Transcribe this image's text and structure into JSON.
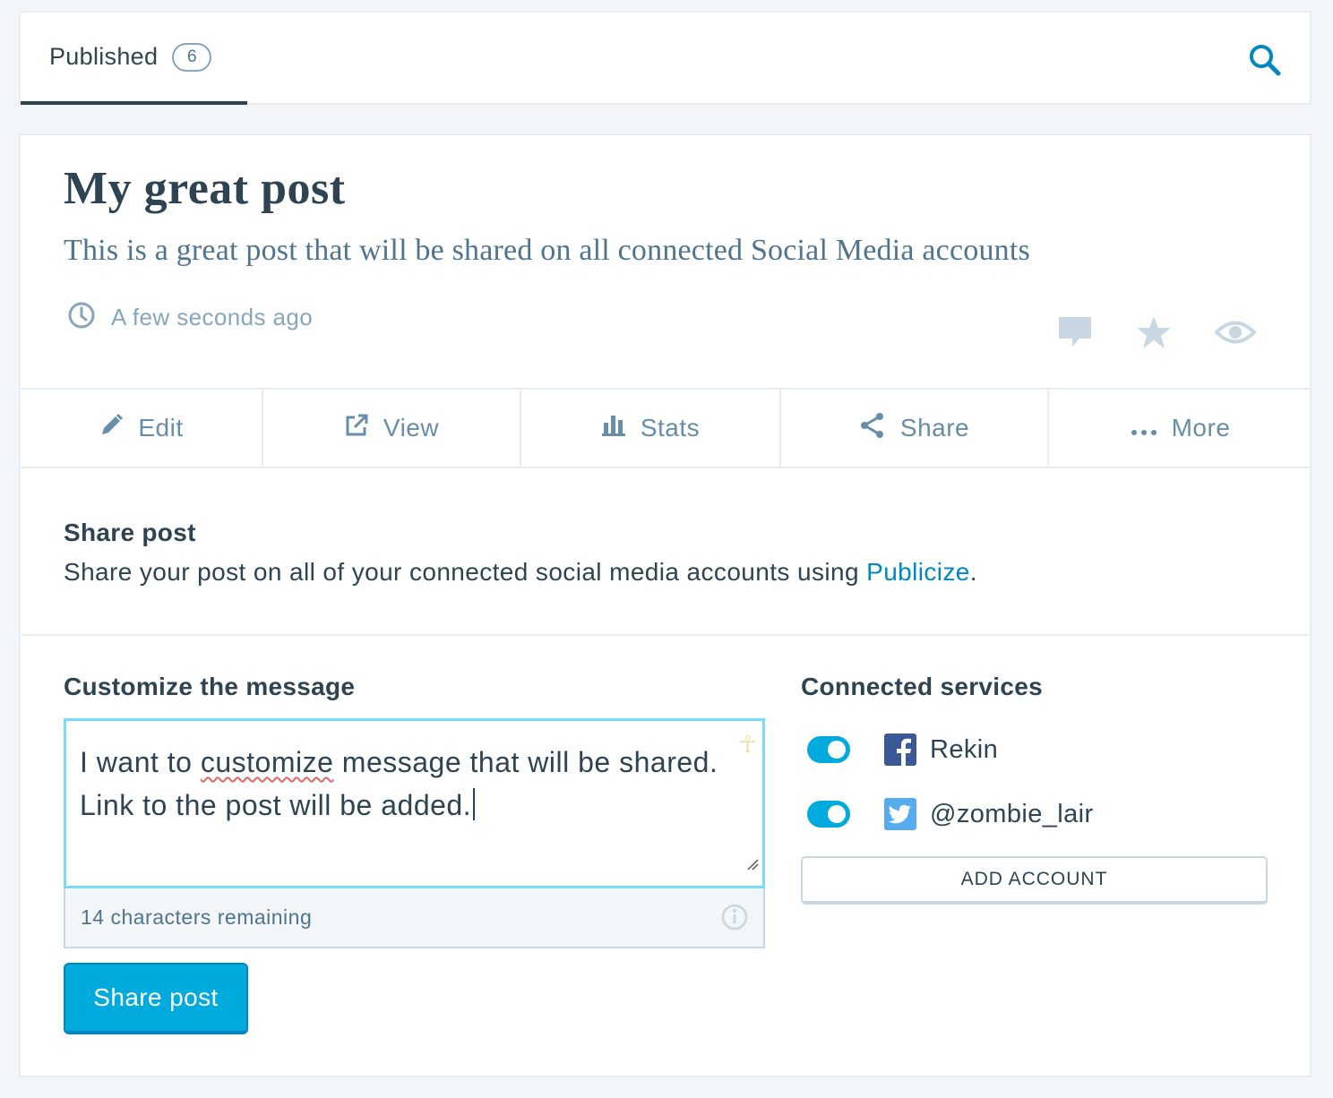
{
  "nav": {
    "tab_label": "Published",
    "tab_count": "6",
    "search_icon": "search-icon"
  },
  "post": {
    "title": "My great post",
    "excerpt": "This is a great post that will be shared on all connected Social Media accounts",
    "time": "A few seconds ago",
    "icons": [
      "comment-icon",
      "star-icon",
      "eye-icon"
    ]
  },
  "actions": [
    {
      "label": "Edit",
      "icon": "pencil-icon"
    },
    {
      "label": "View",
      "icon": "external-link-icon"
    },
    {
      "label": "Stats",
      "icon": "stats-icon"
    },
    {
      "label": "Share",
      "icon": "share-icon"
    },
    {
      "label": "More",
      "icon": "ellipsis-icon"
    }
  ],
  "share": {
    "title": "Share post",
    "description": "Share your post on all of your connected social media accounts using",
    "link_text": "Publicize",
    "description_end": "."
  },
  "customize": {
    "label": "Customize the message",
    "message_line1_before": "I want to",
    "message_line1_misspelled": "customize",
    "message_line1_after": "message that will be shared.",
    "message_line2": "Link to the post will be added.",
    "counter": "14 characters remaining",
    "button": "Share post"
  },
  "services": {
    "label": "Connected services",
    "items": [
      {
        "name": "Rekin",
        "network": "facebook",
        "enabled": true,
        "color": "#3b5998"
      },
      {
        "name": "@zombie_lair",
        "network": "twitter",
        "enabled": true,
        "color": "#55acee"
      }
    ],
    "add_account": "ADD ACCOUNT"
  },
  "colors": {
    "accent": "#00aadc",
    "link": "#0087be",
    "text": "#2e4453",
    "muted": "#87a6bc"
  }
}
